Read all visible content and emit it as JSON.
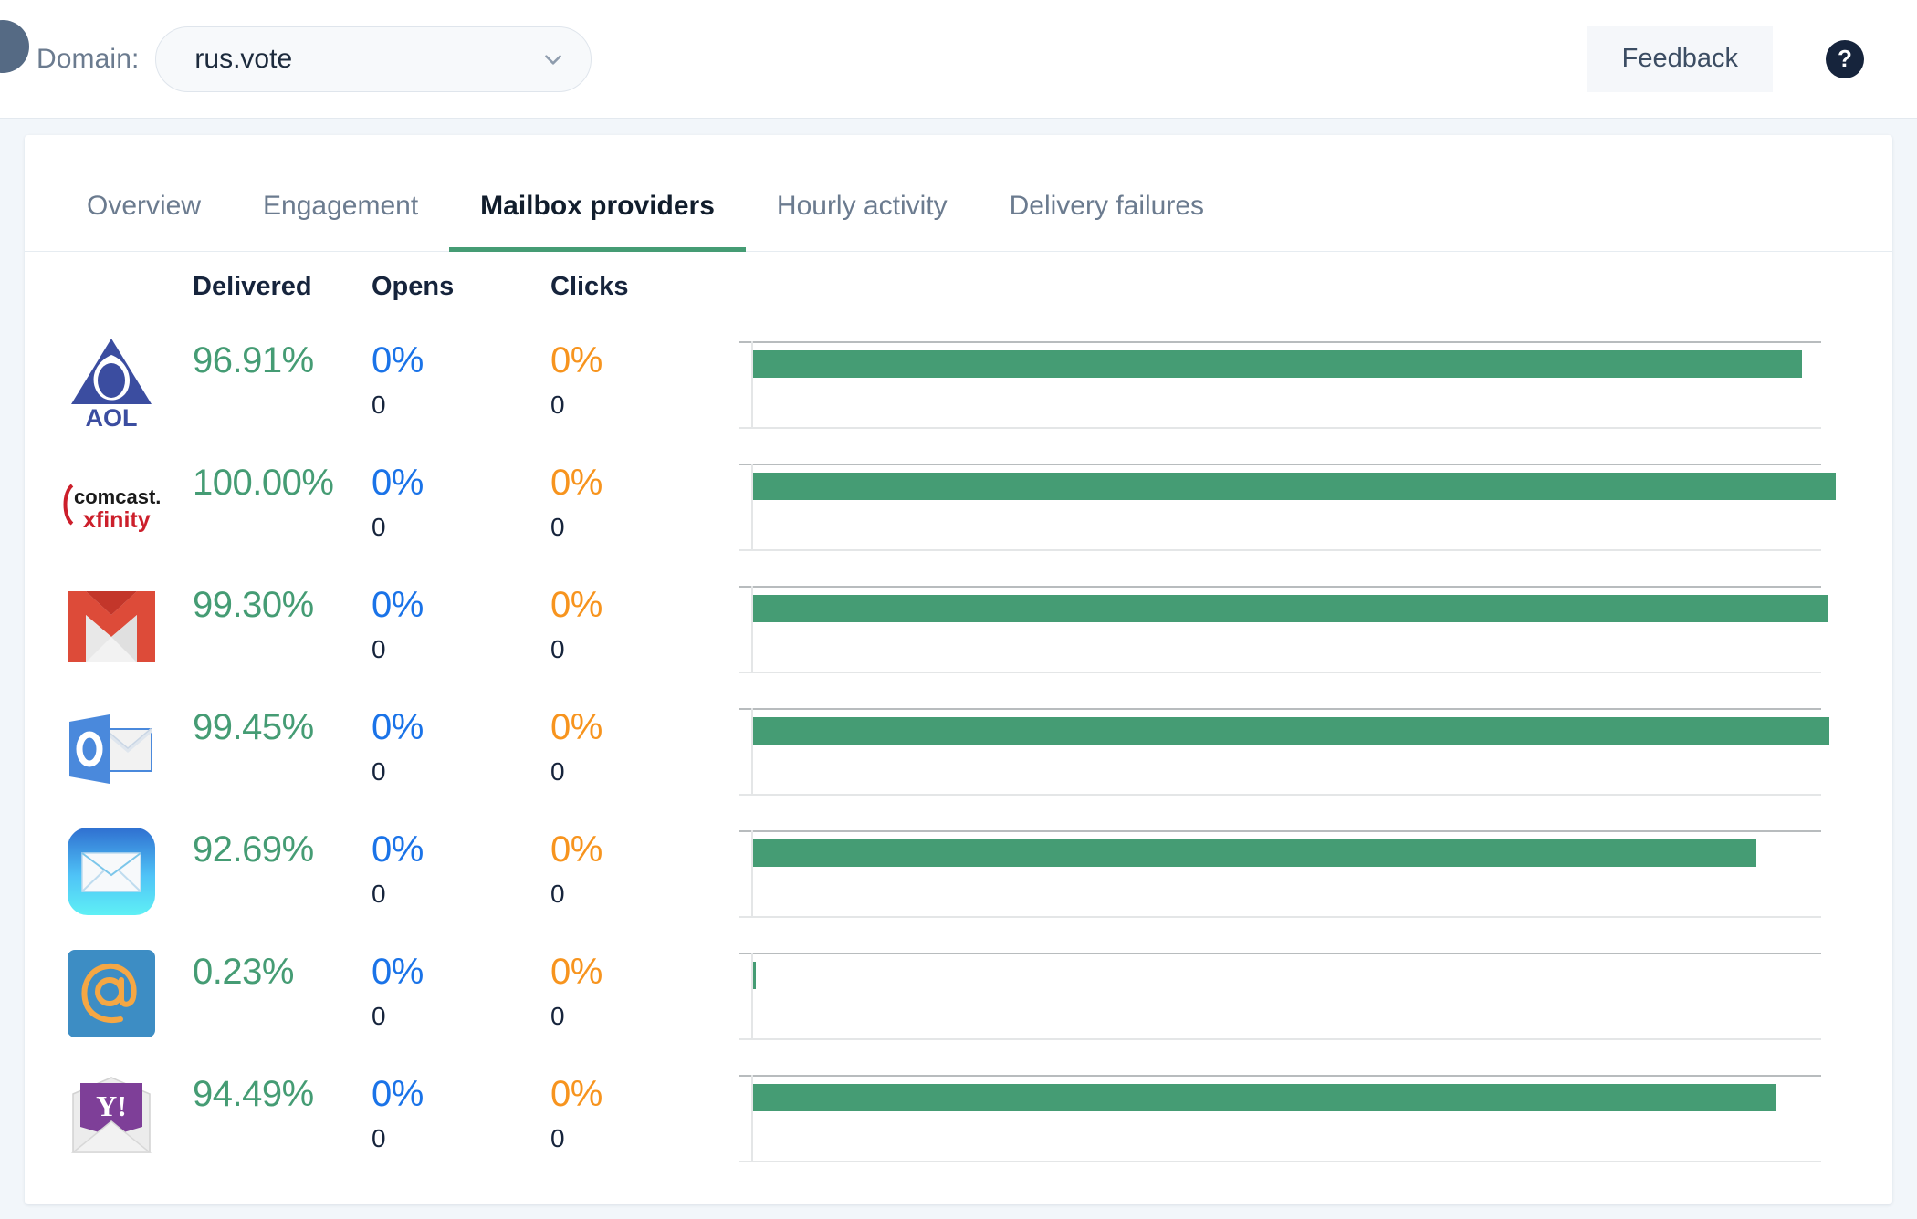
{
  "topbar": {
    "avatar": "user-avatar",
    "domain_label": "Domain:",
    "domain_value": "rus.vote",
    "feedback_label": "Feedback",
    "help_label": "?"
  },
  "tabs": [
    {
      "label": "Overview",
      "active": false
    },
    {
      "label": "Engagement",
      "active": false
    },
    {
      "label": "Mailbox providers",
      "active": true
    },
    {
      "label": "Hourly activity",
      "active": false
    },
    {
      "label": "Delivery failures",
      "active": false
    }
  ],
  "columns": {
    "delivered": "Delivered",
    "opens": "Opens",
    "clicks": "Clicks"
  },
  "colors": {
    "delivered": "#459c74",
    "opens": "#1a73e8",
    "clicks": "#f7941e",
    "bar": "#459c74",
    "tab_underline": "#459c74",
    "page_bg": "#f2f6fa"
  },
  "rows": [
    {
      "provider": "AOL",
      "logo": "aol-logo",
      "delivered_pct": "96.91%",
      "opens_pct": "0%",
      "opens_count": "0",
      "clicks_pct": "0%",
      "clicks_count": "0",
      "bar_value": 96.91
    },
    {
      "provider": "Comcast Xfinity",
      "logo": "comcast-xfinity-logo",
      "delivered_pct": "100.00%",
      "opens_pct": "0%",
      "opens_count": "0",
      "clicks_pct": "0%",
      "clicks_count": "0",
      "bar_value": 100.0
    },
    {
      "provider": "Gmail",
      "logo": "gmail-logo",
      "delivered_pct": "99.30%",
      "opens_pct": "0%",
      "opens_count": "0",
      "clicks_pct": "0%",
      "clicks_count": "0",
      "bar_value": 99.3
    },
    {
      "provider": "Outlook",
      "logo": "outlook-logo",
      "delivered_pct": "99.45%",
      "opens_pct": "0%",
      "opens_count": "0",
      "clicks_pct": "0%",
      "clicks_count": "0",
      "bar_value": 99.45
    },
    {
      "provider": "Apple Mail",
      "logo": "apple-mail-logo",
      "delivered_pct": "92.69%",
      "opens_pct": "0%",
      "opens_count": "0",
      "clicks_pct": "0%",
      "clicks_count": "0",
      "bar_value": 92.69
    },
    {
      "provider": "Other",
      "logo": "at-sign-mail-logo",
      "delivered_pct": "0.23%",
      "opens_pct": "0%",
      "opens_count": "0",
      "clicks_pct": "0%",
      "clicks_count": "0",
      "bar_value": 0.23
    },
    {
      "provider": "Yahoo",
      "logo": "yahoo-mail-logo",
      "delivered_pct": "94.49%",
      "opens_pct": "0%",
      "opens_count": "0",
      "clicks_pct": "0%",
      "clicks_count": "0",
      "bar_value": 94.49
    }
  ],
  "chart_data": {
    "type": "bar",
    "title": "",
    "xlabel": "",
    "ylabel": "",
    "orientation": "horizontal",
    "categories": [
      "AOL",
      "Comcast Xfinity",
      "Gmail",
      "Outlook",
      "Apple Mail",
      "Other",
      "Yahoo"
    ],
    "values": [
      96.91,
      100.0,
      99.3,
      99.45,
      92.69,
      0.23,
      94.49
    ],
    "series": [
      {
        "name": "Delivered",
        "values": [
          96.91,
          100.0,
          99.3,
          99.45,
          92.69,
          0.23,
          94.49
        ]
      }
    ],
    "xlim": [
      0,
      100
    ],
    "grid": true,
    "legend": "none",
    "unit": "%"
  }
}
